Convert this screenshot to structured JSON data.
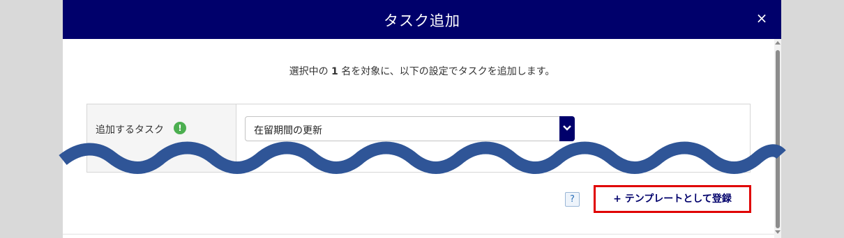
{
  "dialog": {
    "title": "タスク追加",
    "close_icon": "×"
  },
  "description": {
    "prefix": "選択中の ",
    "count": "1",
    "suffix": " 名を対象に、以下の設定でタスクを追加します。"
  },
  "form": {
    "task_label": "追加するタスク",
    "info_icon": "!",
    "task_select_value": "在留期間の更新"
  },
  "footer": {
    "help_icon": "?",
    "template_button_label": "+ テンプレートとして登録"
  },
  "colors": {
    "header_bg": "#00006b",
    "highlight_border": "#e00000",
    "info_green": "#4caf50",
    "wave": "#2f5597"
  }
}
